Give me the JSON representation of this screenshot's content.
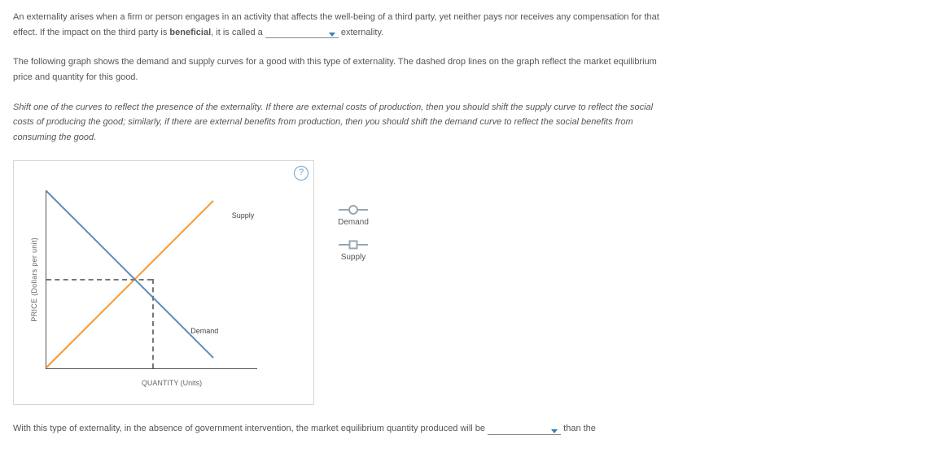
{
  "intro": {
    "part1": "An externality arises when a firm or person engages in an activity that affects the well-being of a third party, yet neither pays nor receives any compensation for that effect. If the impact on the third party is ",
    "bold1": "beneficial",
    "part2": ", it is called a ",
    "part3": " externality."
  },
  "para2": "The following graph shows the demand and supply curves for a good with this type of externality. The dashed drop lines on the graph reflect the market equilibrium price and quantity for this good.",
  "para3": "Shift one of the curves to reflect the presence of the externality. If there are external costs of production, then you should shift the supply curve to reflect the social costs of producing the good; similarly, if there are external benefits from production, then you should shift the demand curve to reflect the social benefits from consuming the good.",
  "help_icon": "?",
  "chart_data": {
    "type": "line",
    "series": [
      {
        "name": "Supply",
        "points": [
          [
            0,
            0
          ],
          [
            10,
            10
          ]
        ],
        "color": "#f79b2e"
      },
      {
        "name": "Demand",
        "points": [
          [
            0,
            10
          ],
          [
            10,
            0
          ]
        ],
        "color": "#5a8db8"
      }
    ],
    "equilibrium": {
      "x": 5,
      "y": 5
    },
    "xlabel": "QUANTITY (Units)",
    "ylabel": "PRICE (Dollars per unit)",
    "curve_labels": {
      "supply": "Supply",
      "demand": "Demand"
    }
  },
  "legend": {
    "demand": "Demand",
    "supply": "Supply"
  },
  "footer": {
    "part1": "With this type of externality, in the absence of government intervention, the market equilibrium quantity produced will be ",
    "part2": " than the"
  }
}
